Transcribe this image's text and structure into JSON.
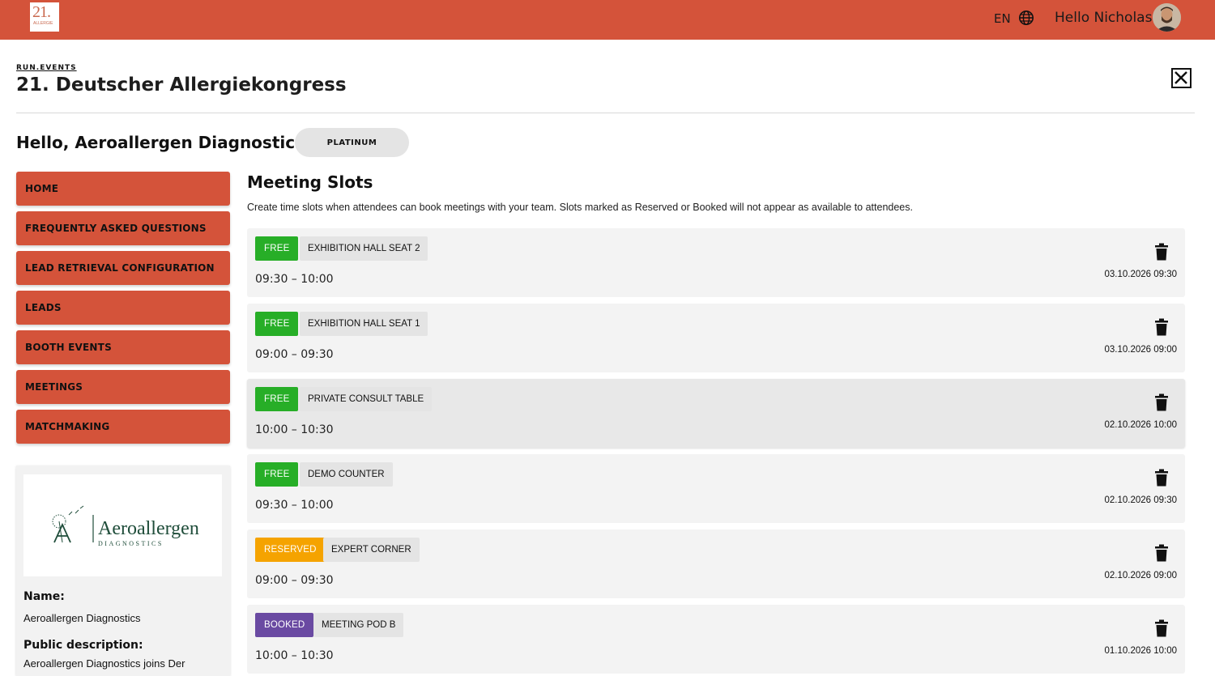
{
  "topbar": {
    "logo_number": "21.",
    "logo_sub": "ALLERGIE",
    "language": "EN",
    "user_greeting": "Hello Nicholas",
    "globe_icon": "globe-icon",
    "avatar_icon": "user-avatar"
  },
  "header": {
    "breadcrumb": "RUN.EVENTS",
    "event_title": "21. Deutscher Allergiekongress",
    "close_icon": "close-icon"
  },
  "exhibitor": {
    "greeting": "Hello, Aeroallergen Diagnostics! :)",
    "tier": "PLATINUM"
  },
  "sidebar": {
    "items": [
      {
        "label": "HOME"
      },
      {
        "label": "FREQUENTLY ASKED QUESTIONS"
      },
      {
        "label": "LEAD RETRIEVAL CONFIGURATION"
      },
      {
        "label": "LEADS"
      },
      {
        "label": "BOOTH EVENTS"
      },
      {
        "label": "MEETINGS"
      },
      {
        "label": "MATCHMAKING"
      }
    ]
  },
  "company": {
    "logo_name": "Aeroallergen",
    "logo_tagline": "DIAGNOSTICS",
    "name_label": "Name:",
    "name_value": "Aeroallergen Diagnostics",
    "description_label": "Public description:",
    "description_value": "Aeroallergen Diagnostics joins Der"
  },
  "meeting_slots": {
    "title": "Meeting Slots",
    "description": "Create time slots when attendees can book meetings with your team. Slots marked as Reserved or Booked will not appear as available to attendees.",
    "slots": [
      {
        "status": "FREE",
        "location": "EXHIBITION HALL SEAT 2",
        "time": "09:30 – 10:00",
        "date": "03.10.2026 09:30"
      },
      {
        "status": "FREE",
        "location": "EXHIBITION HALL SEAT 1",
        "time": "09:00 – 09:30",
        "date": "03.10.2026 09:00"
      },
      {
        "status": "FREE",
        "location": "PRIVATE CONSULT TABLE",
        "time": "10:00 – 10:30",
        "date": "02.10.2026 10:00"
      },
      {
        "status": "FREE",
        "location": "DEMO COUNTER",
        "time": "09:30 – 10:00",
        "date": "02.10.2026 09:30"
      },
      {
        "status": "RESERVED",
        "location": "EXPERT CORNER",
        "time": "09:00 – 09:30",
        "date": "02.10.2026 09:00"
      },
      {
        "status": "BOOKED",
        "location": "MEETING POD B",
        "time": "10:00 – 10:30",
        "date": "01.10.2026 10:00"
      }
    ]
  },
  "colors": {
    "brand": "#d4533a",
    "free": "#27ae27",
    "reserved": "#f5a300",
    "booked": "#6a4aa2"
  }
}
